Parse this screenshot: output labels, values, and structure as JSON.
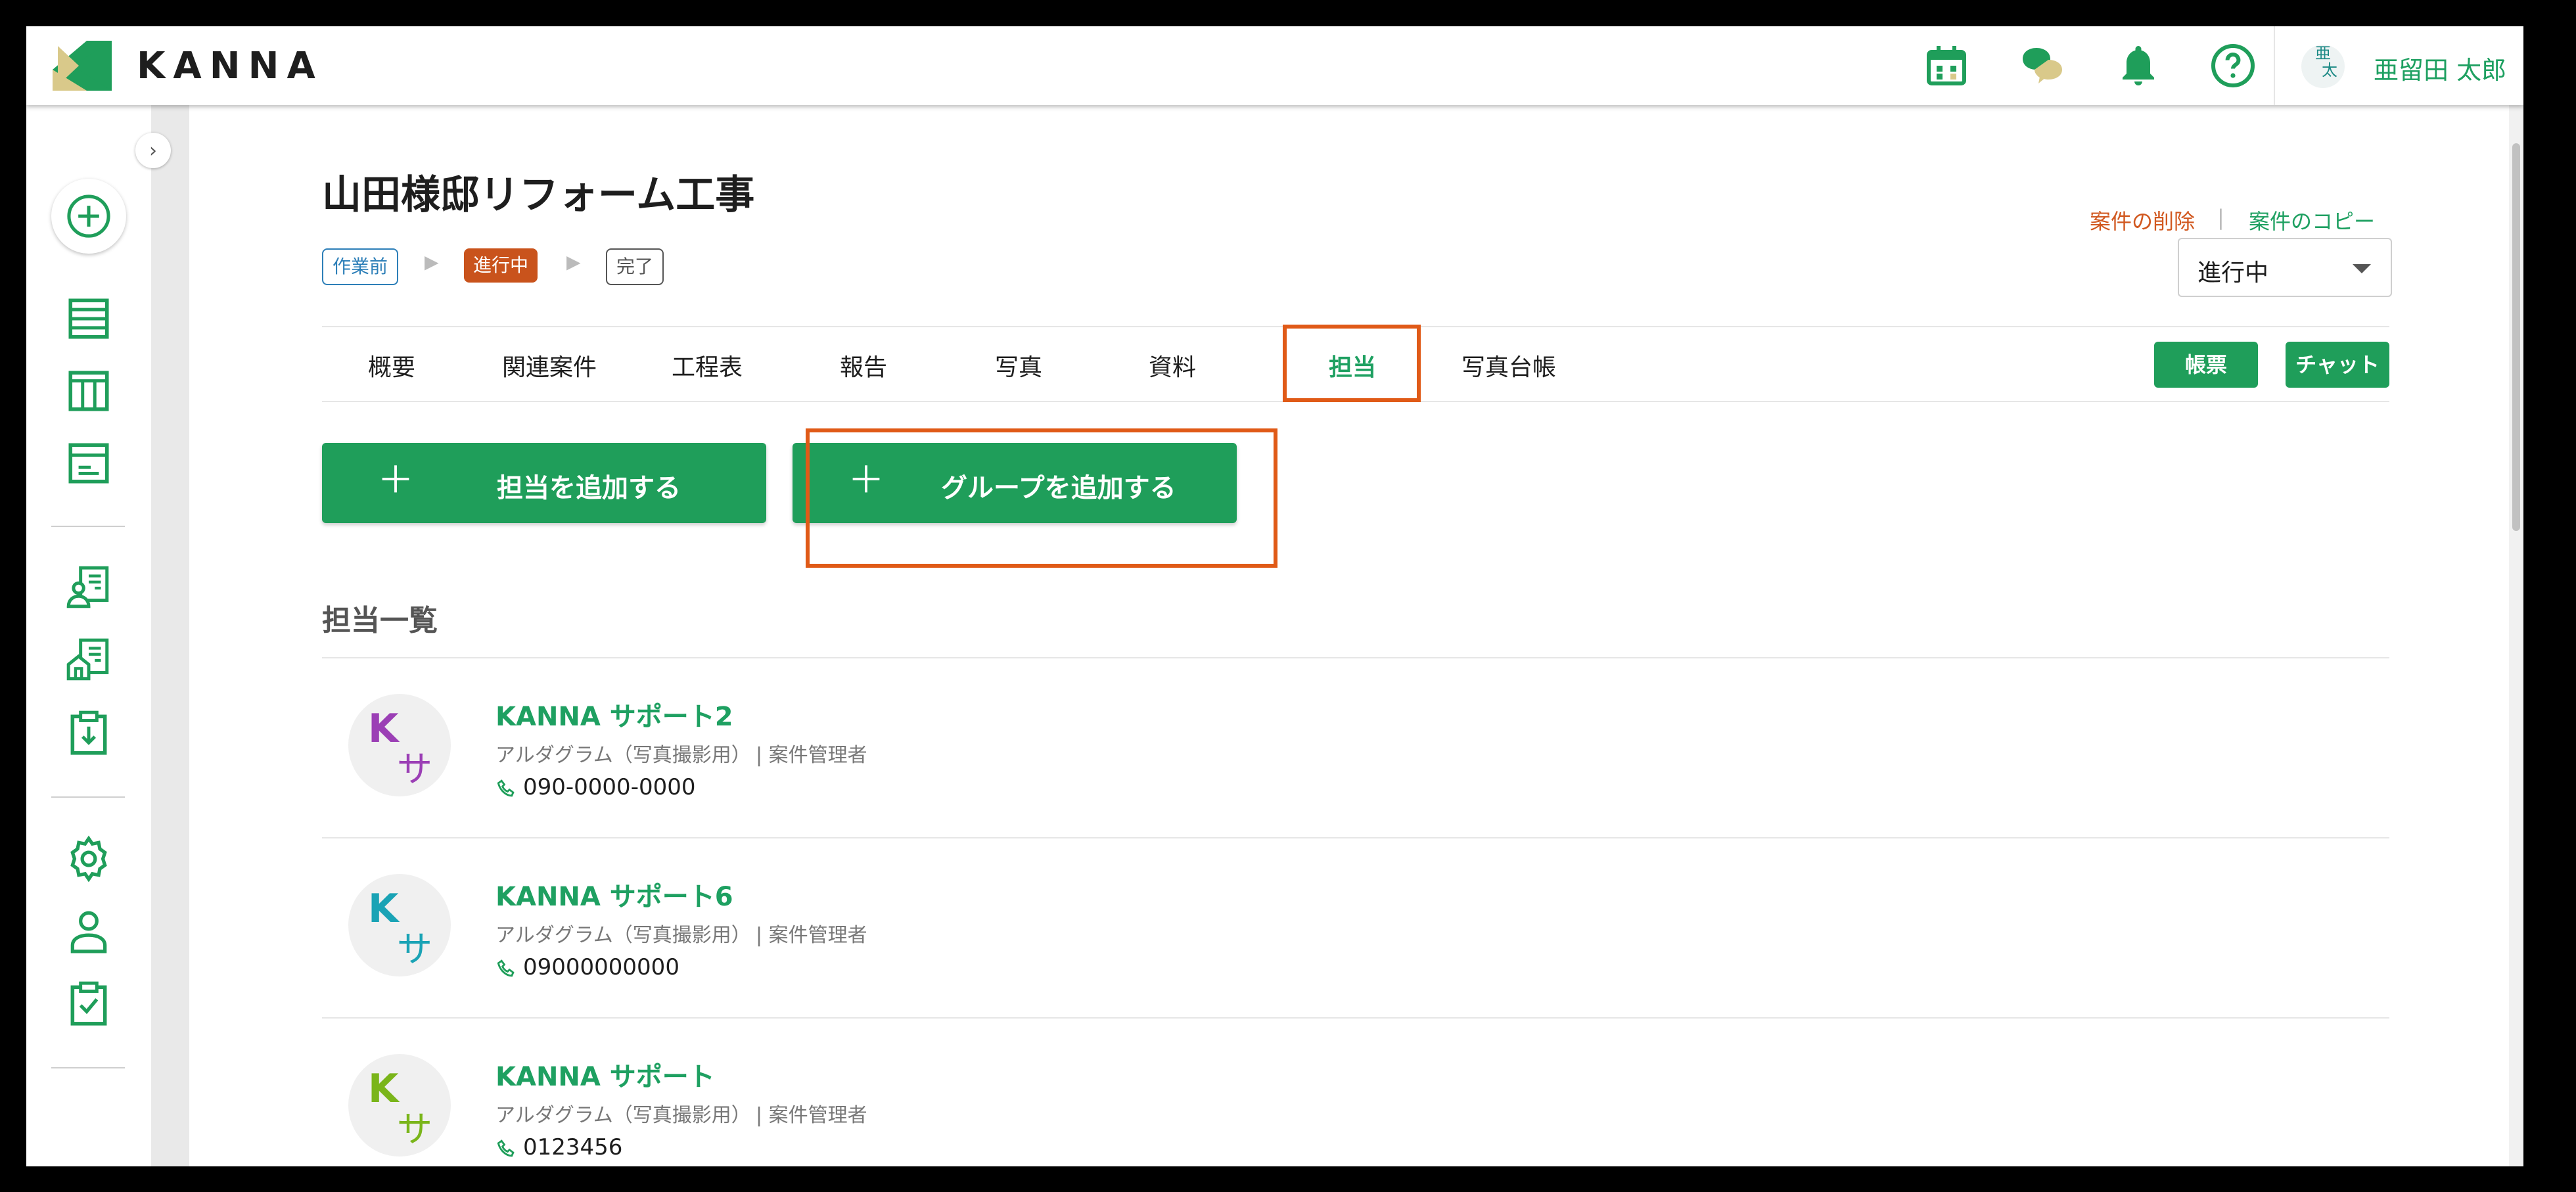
{
  "app": {
    "logo_text": "KANNA",
    "brand_color": "#1ea061",
    "accent_orange": "#e05a17"
  },
  "header": {
    "icons": [
      "calendar-icon",
      "chat-bubbles-icon",
      "bell-icon",
      "help-icon"
    ],
    "user": {
      "avatar_top": "亜",
      "avatar_bottom": "太",
      "name": "亜留田 太郎"
    }
  },
  "sidebar": {
    "collapse_glyph": "›",
    "icons": [
      "add-circle-icon",
      "list-icon",
      "columns-icon",
      "document-icon",
      "person-card-icon",
      "house-card-icon",
      "download-clipboard-icon",
      "gear-icon",
      "person-icon",
      "checklist-icon"
    ]
  },
  "project": {
    "title": "山田様邸リフォーム工事",
    "statuses": {
      "pre": "作業前",
      "active": "進行中",
      "done": "完了"
    },
    "arrow": "▶",
    "delete_link": "案件の削除",
    "link_sep": "|",
    "copy_link": "案件のコピー",
    "status_select": "進行中"
  },
  "tabs": [
    {
      "label": "概要"
    },
    {
      "label": "関連案件"
    },
    {
      "label": "工程表"
    },
    {
      "label": "報告"
    },
    {
      "label": "写真"
    },
    {
      "label": "資料"
    },
    {
      "label": "担当"
    },
    {
      "label": "写真台帳"
    }
  ],
  "buttons": {
    "report": "帳票",
    "chat": "チャット",
    "add_member": "担当を追加する",
    "add_group": "グループを追加する",
    "plus": "＋"
  },
  "members": {
    "section_title": "担当一覧",
    "items": [
      {
        "initial": "K",
        "kana": "サ",
        "color": "#9b3fb5",
        "name": "KANNA サポート2",
        "org": "アルダグラム（写真撮影用）",
        "role": "| 案件管理者",
        "phone": "090-0000-0000"
      },
      {
        "initial": "K",
        "kana": "サ",
        "color": "#1aa3b5",
        "name": "KANNA サポート6",
        "org": "アルダグラム（写真撮影用）",
        "role": "| 案件管理者",
        "phone": "09000000000"
      },
      {
        "initial": "K",
        "kana": "サ",
        "color": "#7ab51a",
        "name": "KANNA サポート",
        "org": "アルダグラム（写真撮影用）",
        "role": "| 案件管理者",
        "phone": "0123456"
      }
    ]
  }
}
